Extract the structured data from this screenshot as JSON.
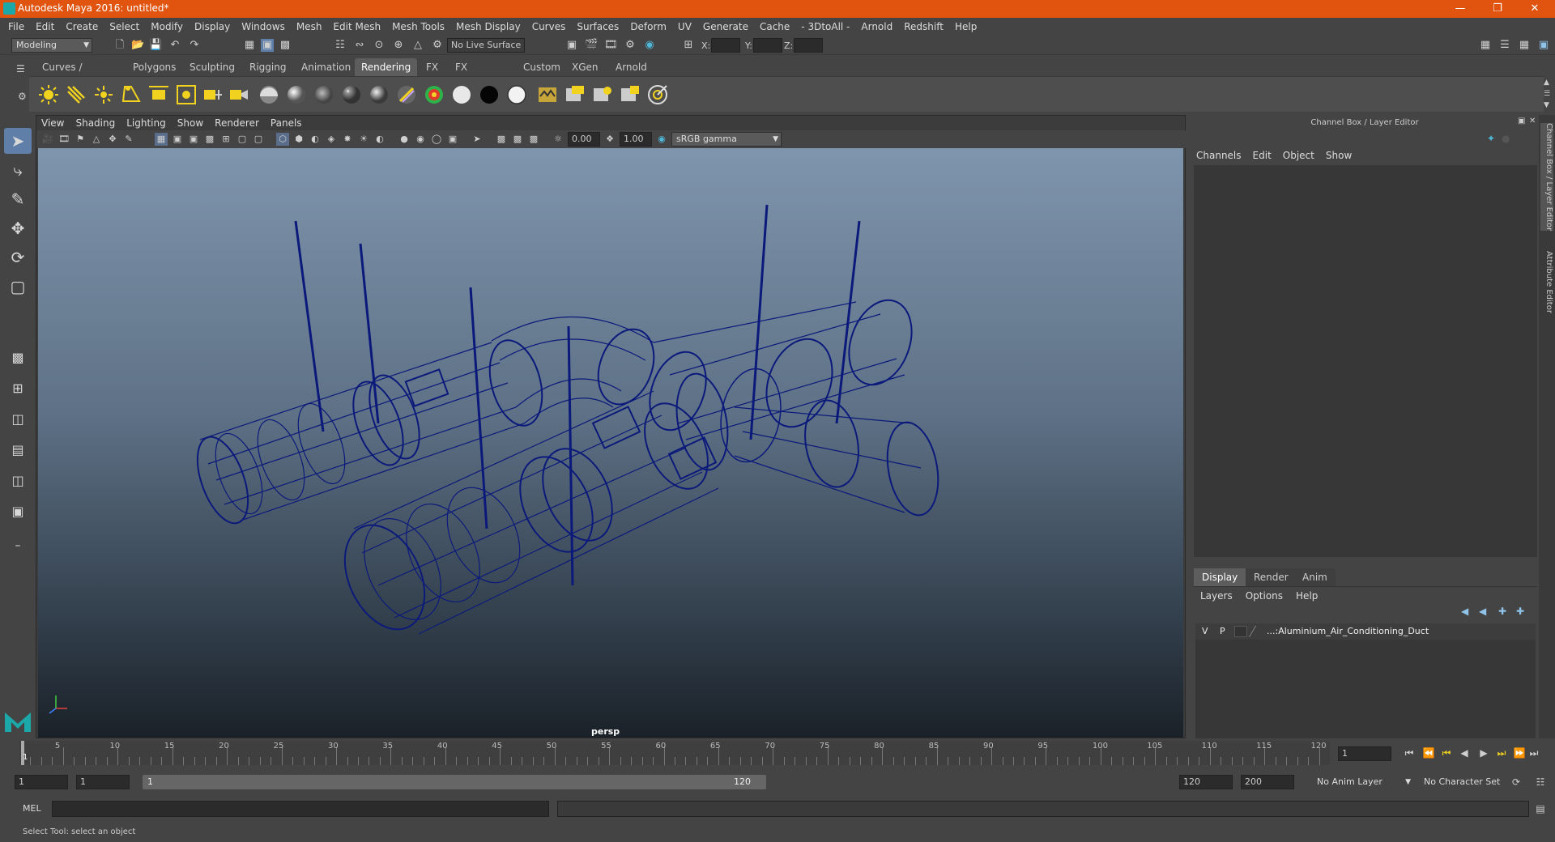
{
  "window": {
    "title": "Autodesk Maya 2016: untitled*"
  },
  "menu": [
    "File",
    "Edit",
    "Create",
    "Select",
    "Modify",
    "Display",
    "Windows",
    "Mesh",
    "Edit Mesh",
    "Mesh Tools",
    "Mesh Display",
    "Curves",
    "Surfaces",
    "Deform",
    "UV",
    "Generate",
    "Cache",
    "- 3DtoAll -",
    "Arnold",
    "Redshift",
    "Help"
  ],
  "status": {
    "mode": "Modeling",
    "live_surface": "No Live Surface",
    "x_label": "X:",
    "y_label": "Y:",
    "z_label": "Z:"
  },
  "shelf_tabs": [
    "Curves / Surfaces",
    "Polygons",
    "Sculpting",
    "Rigging",
    "Animation",
    "Rendering",
    "FX",
    "FX Caching",
    "Custom",
    "XGen",
    "Arnold"
  ],
  "shelf_active": "Rendering",
  "viewport": {
    "menu": [
      "View",
      "Shading",
      "Lighting",
      "Show",
      "Renderer",
      "Panels"
    ],
    "exposure": "0.00",
    "gamma": "1.00",
    "color_space": "sRGB gamma",
    "camera": "persp"
  },
  "channel_box": {
    "title": "Channel Box / Layer Editor",
    "menu": [
      "Channels",
      "Edit",
      "Object",
      "Show"
    ]
  },
  "layer_editor": {
    "tabs": [
      "Display",
      "Render",
      "Anim"
    ],
    "active_tab": "Display",
    "menu": [
      "Layers",
      "Options",
      "Help"
    ],
    "layer": {
      "v": "V",
      "p": "P",
      "name": "...:Aluminium_Air_Conditioning_Duct"
    }
  },
  "side_tabs": [
    "Channel Box / Layer Editor",
    "Attribute Editor"
  ],
  "timeline": {
    "ticks": [
      5,
      10,
      15,
      20,
      25,
      30,
      35,
      40,
      45,
      50,
      55,
      60,
      65,
      70,
      75,
      80,
      85,
      90,
      95,
      100,
      105,
      110,
      115,
      120
    ],
    "current_frame": "1",
    "start_label": "1"
  },
  "range": {
    "start": "1",
    "playback_start": "1",
    "slider_start": "1",
    "slider_end": "120",
    "playback_end": "120",
    "end": "200",
    "anim_layer": "No Anim Layer",
    "character_set": "No Character Set"
  },
  "command": {
    "label": "MEL"
  },
  "help": {
    "text": "Select Tool: select an object"
  },
  "colors": {
    "title_bar": "#e0540f",
    "wireframe": "#0b1a7a",
    "accent": "#1ca8a8"
  }
}
